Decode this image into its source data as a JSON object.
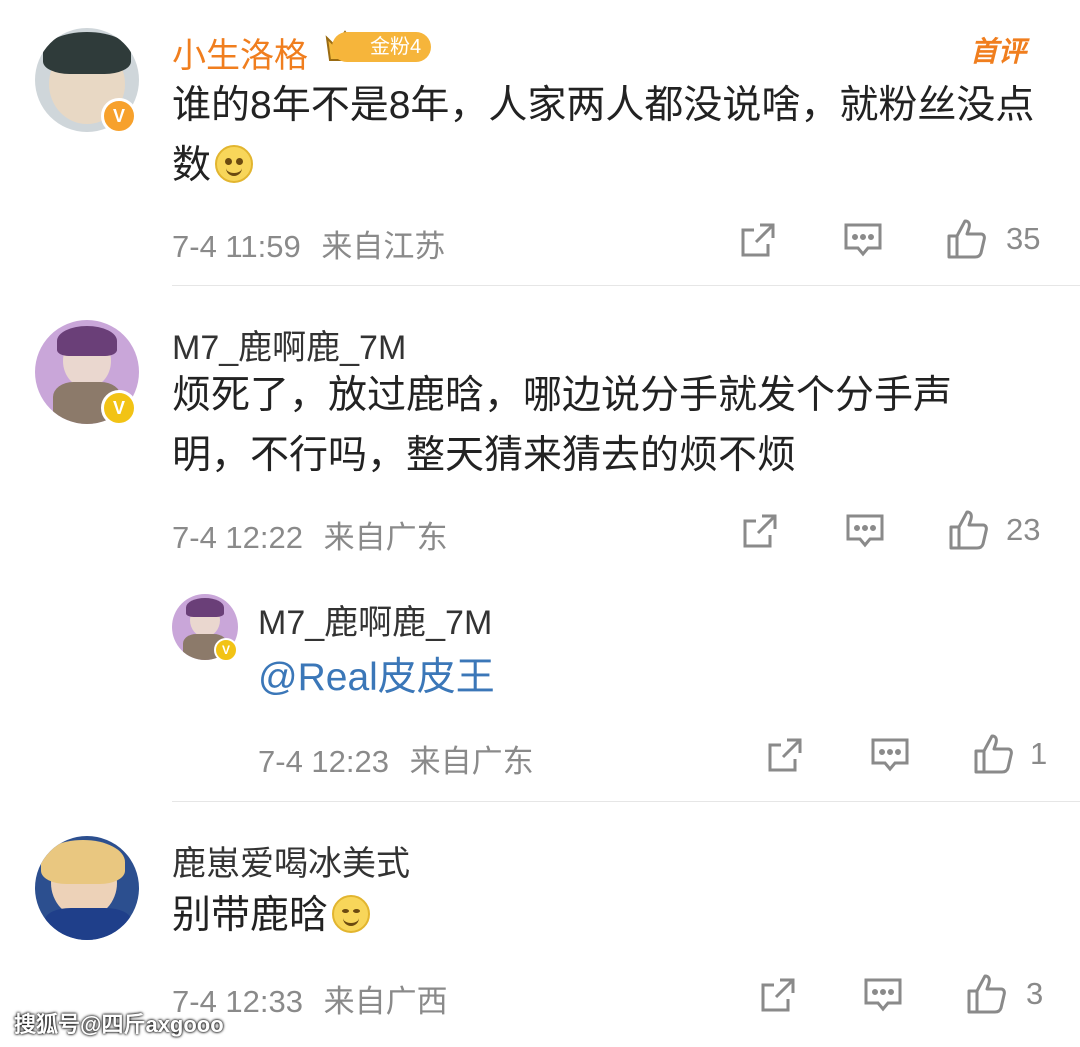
{
  "comments": [
    {
      "username": "小生洛格",
      "fan_badge": "金粉4",
      "top_tag": "首评",
      "text": "谁的8年不是8年，人家两人都没说啥，就粉丝没点数",
      "time": "7-4 11:59",
      "location": "来自江苏",
      "likes": "35"
    },
    {
      "username": "M7_鹿啊鹿_7M",
      "text": "烦死了，放过鹿晗，哪边说分手就发个分手声明，不行吗，整天猜来猜去的烦不烦",
      "time": "7-4 12:22",
      "location": "来自广东",
      "likes": "23",
      "reply": {
        "username": "M7_鹿啊鹿_7M",
        "text": "@Real皮皮王",
        "time": "7-4 12:23",
        "location": "来自广东",
        "likes": "1"
      }
    },
    {
      "username": "鹿崽爱喝冰美式",
      "text": "别带鹿晗",
      "time": "7-4 12:33",
      "location": "来自广西",
      "likes": "3"
    }
  ],
  "watermark": "搜狐号@四斤axgooo",
  "icons": {
    "repost": "share-box-icon",
    "comment": "comment-bubble-icon",
    "like": "thumbs-up-icon",
    "verified": "verified-v-icon"
  },
  "colors": {
    "username_highlight": "#f07e1e",
    "mention": "#3b77b8",
    "meta": "#8a8a8a",
    "badge": "#f6b53b"
  }
}
